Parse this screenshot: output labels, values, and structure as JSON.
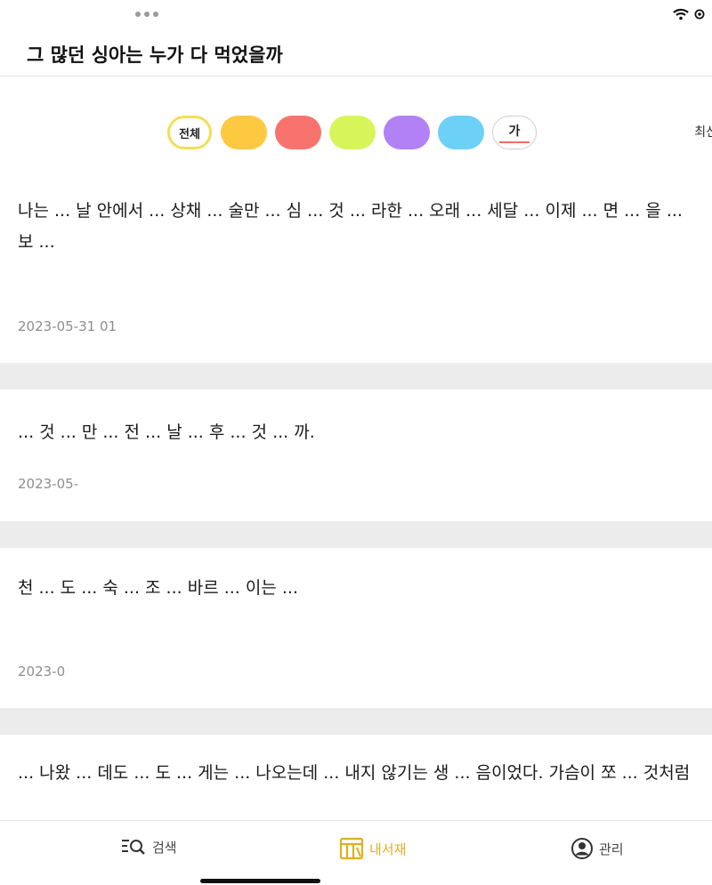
{
  "header": {
    "title": "그 많던 싱아는 누가 다 먹었을까"
  },
  "filters": {
    "all_label": "전체",
    "colors": [
      "#fdc941",
      "#f9736e",
      "#d7f55a",
      "#b181f5",
      "#6dd0f7"
    ],
    "text_chip_label": "가",
    "sort_label": "최신"
  },
  "notes": [
    {
      "text": "나는 ... 날 안에서 ... 상채 ... 술만 ... 심 ... 것 ... 라한 ... 오래 ... 세달 ... 이제 ... 면 ... 을 ... 보 ...",
      "date": "2023-05-31 01"
    },
    {
      "text": "... 것 ... 만 ... 전 ... 날 ... 후 ... 것 ... 까.",
      "date": "2023-05-"
    },
    {
      "text": "천 ... 도 ... 숙 ... 조 ... 바르 ... 이는 ...",
      "date": "2023-0"
    },
    {
      "text": "... 나왔 ... 데도 ... 도 ... 게는 ... 나오는데 ... 내지 않기는 생 ... 음이었다. 가슴이 쪼 ... 것처럼",
      "date": ""
    }
  ],
  "nav": {
    "search_label": "검색",
    "library_label": "내서재",
    "manage_label": "관리"
  }
}
